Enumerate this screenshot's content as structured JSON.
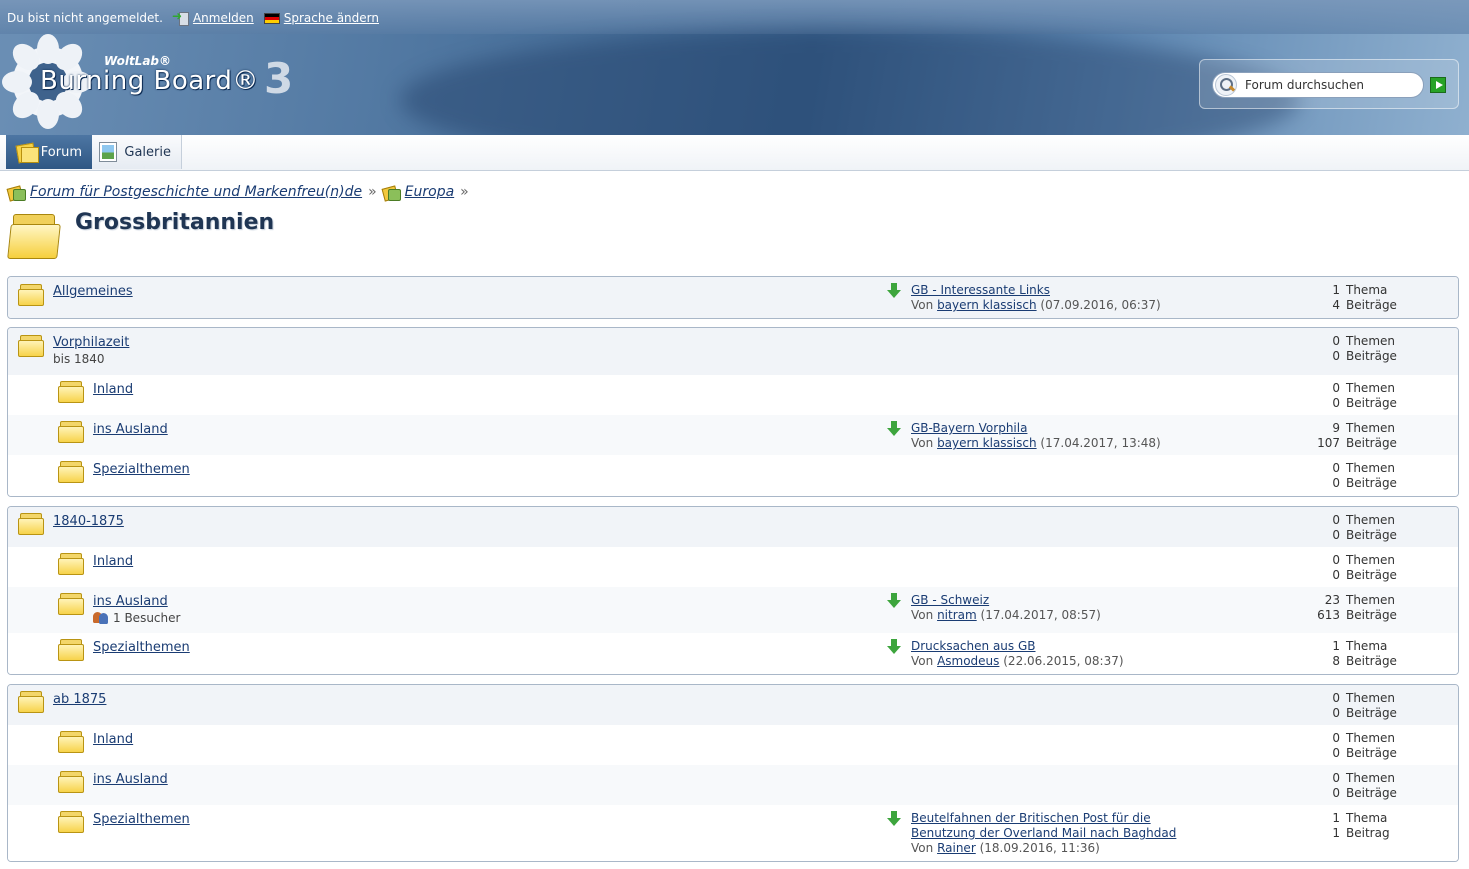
{
  "header": {
    "not_logged_in": "Du bist nicht angemeldet.",
    "login": "Anmelden",
    "language": "Sprache ändern",
    "logo_brand": "WoltLab®",
    "logo_name": "Burning Board®",
    "logo_version": "3",
    "search_placeholder": "Forum durchsuchen"
  },
  "nav": {
    "tabs": [
      {
        "label": "Forum",
        "icon": "forum-icon"
      },
      {
        "label": "Galerie",
        "icon": "gallery-icon"
      }
    ]
  },
  "breadcrumb": {
    "items": [
      "Forum für Postgeschichte und Markenfreu(n)de",
      "Europa"
    ],
    "separator": "»"
  },
  "page": {
    "title": "Grossbritannien"
  },
  "boxes": [
    {
      "name": "Allgemeines",
      "last": {
        "title": "GB - Interessante Links",
        "by_prefix": "Von",
        "user": "bayern klassisch",
        "date": "(07.09.2016, 06:37)"
      },
      "stats": {
        "topics": "1",
        "topics_label": "Thema",
        "posts": "4",
        "posts_label": "Beiträge"
      }
    },
    {
      "name": "Vorphilazeit",
      "desc": "bis 1840",
      "stats": {
        "topics": "0",
        "topics_label": "Themen",
        "posts": "0",
        "posts_label": "Beiträge"
      },
      "subs": [
        {
          "name": "Inland",
          "stats": {
            "topics": "0",
            "topics_label": "Themen",
            "posts": "0",
            "posts_label": "Beiträge"
          }
        },
        {
          "name": "ins Ausland",
          "last": {
            "title": "GB-Bayern Vorphila",
            "by_prefix": "Von",
            "user": "bayern klassisch",
            "date": "(17.04.2017, 13:48)"
          },
          "stats": {
            "topics": "9",
            "topics_label": "Themen",
            "posts": "107",
            "posts_label": "Beiträge"
          }
        },
        {
          "name": "Spezialthemen",
          "stats": {
            "topics": "0",
            "topics_label": "Themen",
            "posts": "0",
            "posts_label": "Beiträge"
          }
        }
      ]
    },
    {
      "name": "1840-1875",
      "stats": {
        "topics": "0",
        "topics_label": "Themen",
        "posts": "0",
        "posts_label": "Beiträge"
      },
      "subs": [
        {
          "name": "Inland",
          "stats": {
            "topics": "0",
            "topics_label": "Themen",
            "posts": "0",
            "posts_label": "Beiträge"
          }
        },
        {
          "name": "ins Ausland",
          "visitors": "1 Besucher",
          "last": {
            "title": "GB - Schweiz",
            "by_prefix": "Von",
            "user": "nitram",
            "date": "(17.04.2017, 08:57)"
          },
          "stats": {
            "topics": "23",
            "topics_label": "Themen",
            "posts": "613",
            "posts_label": "Beiträge"
          }
        },
        {
          "name": "Spezialthemen",
          "last": {
            "title": "Drucksachen aus GB",
            "by_prefix": "Von",
            "user": "Asmodeus",
            "date": "(22.06.2015, 08:37)"
          },
          "stats": {
            "topics": "1",
            "topics_label": "Thema",
            "posts": "8",
            "posts_label": "Beiträge"
          }
        }
      ]
    },
    {
      "name": "ab 1875",
      "stats": {
        "topics": "0",
        "topics_label": "Themen",
        "posts": "0",
        "posts_label": "Beiträge"
      },
      "subs": [
        {
          "name": "Inland",
          "stats": {
            "topics": "0",
            "topics_label": "Themen",
            "posts": "0",
            "posts_label": "Beiträge"
          }
        },
        {
          "name": "ins Ausland",
          "stats": {
            "topics": "0",
            "topics_label": "Themen",
            "posts": "0",
            "posts_label": "Beiträge"
          }
        },
        {
          "name": "Spezialthemen",
          "last": {
            "title_line1": "Beutelfahnen der Britischen Post für die",
            "title_line2": "Benutzung der Overland Mail nach Baghdad",
            "by_prefix": "Von",
            "user": "Rainer",
            "date": "(18.09.2016, 11:36)"
          },
          "stats": {
            "topics": "1",
            "topics_label": "Thema",
            "posts": "1",
            "posts_label": "Beitrag"
          }
        }
      ]
    }
  ],
  "colors": {
    "link": "#1a3c73",
    "banner": "#3c648f",
    "arrow": "#3da53d",
    "folder": "#f7d34a"
  }
}
